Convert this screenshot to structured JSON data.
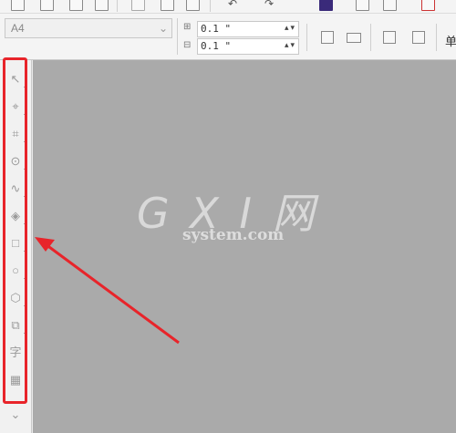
{
  "toolbar": {
    "page_size_value": "A4",
    "nudge_top_value": "0.1 \"",
    "nudge_bottom_value": "0.1 \"",
    "unit_label": "单"
  },
  "watermark": {
    "logo_text": "G X I 网",
    "domain_text": "system.com"
  },
  "toolbox": {
    "text_tool_glyph": "字"
  },
  "colors": {
    "canvas_bg": "#aaaaaa",
    "annotation_red": "#e8242a",
    "highlight_purple": "#3a2a7a"
  },
  "icons": [
    "new-icon",
    "open-icon",
    "save-icon",
    "print-icon",
    "cut-icon",
    "copy-icon",
    "paste-icon",
    "undo-icon",
    "redo-icon",
    "import-icon",
    "export-icon",
    "pick-tool-icon",
    "shape-tool-icon",
    "crop-tool-icon",
    "zoom-tool-icon",
    "freehand-tool-icon",
    "smart-fill-icon",
    "rectangle-tool-icon",
    "ellipse-tool-icon",
    "polygon-tool-icon",
    "basic-shapes-icon",
    "text-tool-icon",
    "table-tool-icon"
  ]
}
